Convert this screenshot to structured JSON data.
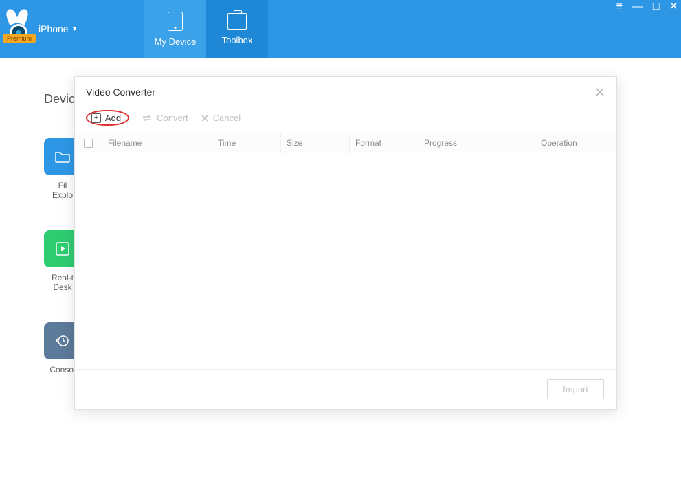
{
  "premium_label": "Premium",
  "device_selector": "iPhone",
  "nav": {
    "my_device": "My Device",
    "toolbox": "Toolbox"
  },
  "bg": {
    "heading_partial": "Devic",
    "tile1_l1": "Fil",
    "tile1_l2": "Explo",
    "tile2_l1": "Real-t",
    "tile2_l2": "Desk",
    "tile3_l1": "Consol"
  },
  "modal": {
    "title": "Video Converter",
    "add": "Add",
    "convert": "Convert",
    "cancel": "Cancel",
    "cols": {
      "filename": "Filename",
      "time": "Time",
      "size": "Size",
      "format": "Format",
      "progress": "Progress",
      "operation": "Operation"
    },
    "import": "Import"
  }
}
